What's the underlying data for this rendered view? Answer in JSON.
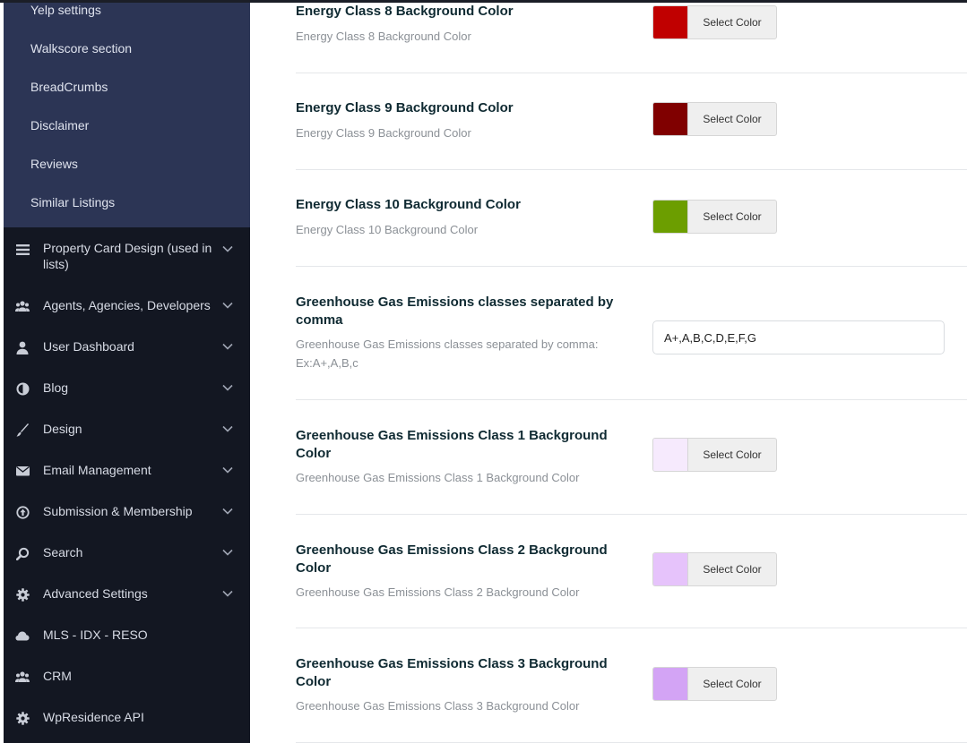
{
  "sidebar": {
    "submenu": [
      "Yelp settings",
      "Walkscore section",
      "BreadCrumbs",
      "Disclaimer",
      "Reviews",
      "Similar Listings"
    ],
    "items": [
      {
        "label": "Property Card Design (used in lists)",
        "icon": "list-icon",
        "chevron": true
      },
      {
        "label": "Agents, Agencies, Developers",
        "icon": "users-icon",
        "chevron": true
      },
      {
        "label": "User Dashboard",
        "icon": "user-icon",
        "chevron": true
      },
      {
        "label": "Blog",
        "icon": "half-circle-icon",
        "chevron": true
      },
      {
        "label": "Design",
        "icon": "brush-icon",
        "chevron": true
      },
      {
        "label": "Email Management",
        "icon": "envelope-icon",
        "chevron": true
      },
      {
        "label": "Submission & Membership",
        "icon": "upload-circle-icon",
        "chevron": true
      },
      {
        "label": "Search",
        "icon": "search-icon",
        "chevron": true
      },
      {
        "label": "Advanced Settings",
        "icon": "gear-icon",
        "chevron": true
      },
      {
        "label": "MLS - IDX - RESO",
        "icon": "cloud-icon",
        "chevron": false
      },
      {
        "label": "CRM",
        "icon": "users-icon",
        "chevron": false
      },
      {
        "label": "WpResidence API",
        "icon": "gear-icon",
        "chevron": false
      }
    ]
  },
  "main": {
    "select_color_label": "Select Color",
    "rows": [
      {
        "title": "Energy Class 8 Background Color",
        "desc": "Energy Class 8 Background Color",
        "type": "color",
        "color": "#c00000"
      },
      {
        "title": "Energy Class 9 Background Color",
        "desc": "Energy Class 9 Background Color",
        "type": "color",
        "color": "#800000"
      },
      {
        "title": "Energy Class 10 Background Color",
        "desc": "Energy Class 10 Background Color",
        "type": "color",
        "color": "#6c9e00"
      },
      {
        "title": "Greenhouse Gas Emissions classes separated by comma",
        "desc": "Greenhouse Gas Emissions classes separated by comma: Ex:A+,A,B,c",
        "type": "text",
        "value": "A+,A,B,C,D,E,F,G"
      },
      {
        "title": "Greenhouse Gas Emissions Class 1 Background Color",
        "desc": "Greenhouse Gas Emissions Class 1 Background Color",
        "type": "color",
        "color": "#f6eafd"
      },
      {
        "title": "Greenhouse Gas Emissions Class 2 Background Color",
        "desc": "Greenhouse Gas Emissions Class 2 Background Color",
        "type": "color",
        "color": "#e6c3fb"
      },
      {
        "title": "Greenhouse Gas Emissions Class 3 Background Color",
        "desc": "Greenhouse Gas Emissions Class 3 Background Color",
        "type": "color",
        "color": "#d3a4f5"
      }
    ]
  }
}
